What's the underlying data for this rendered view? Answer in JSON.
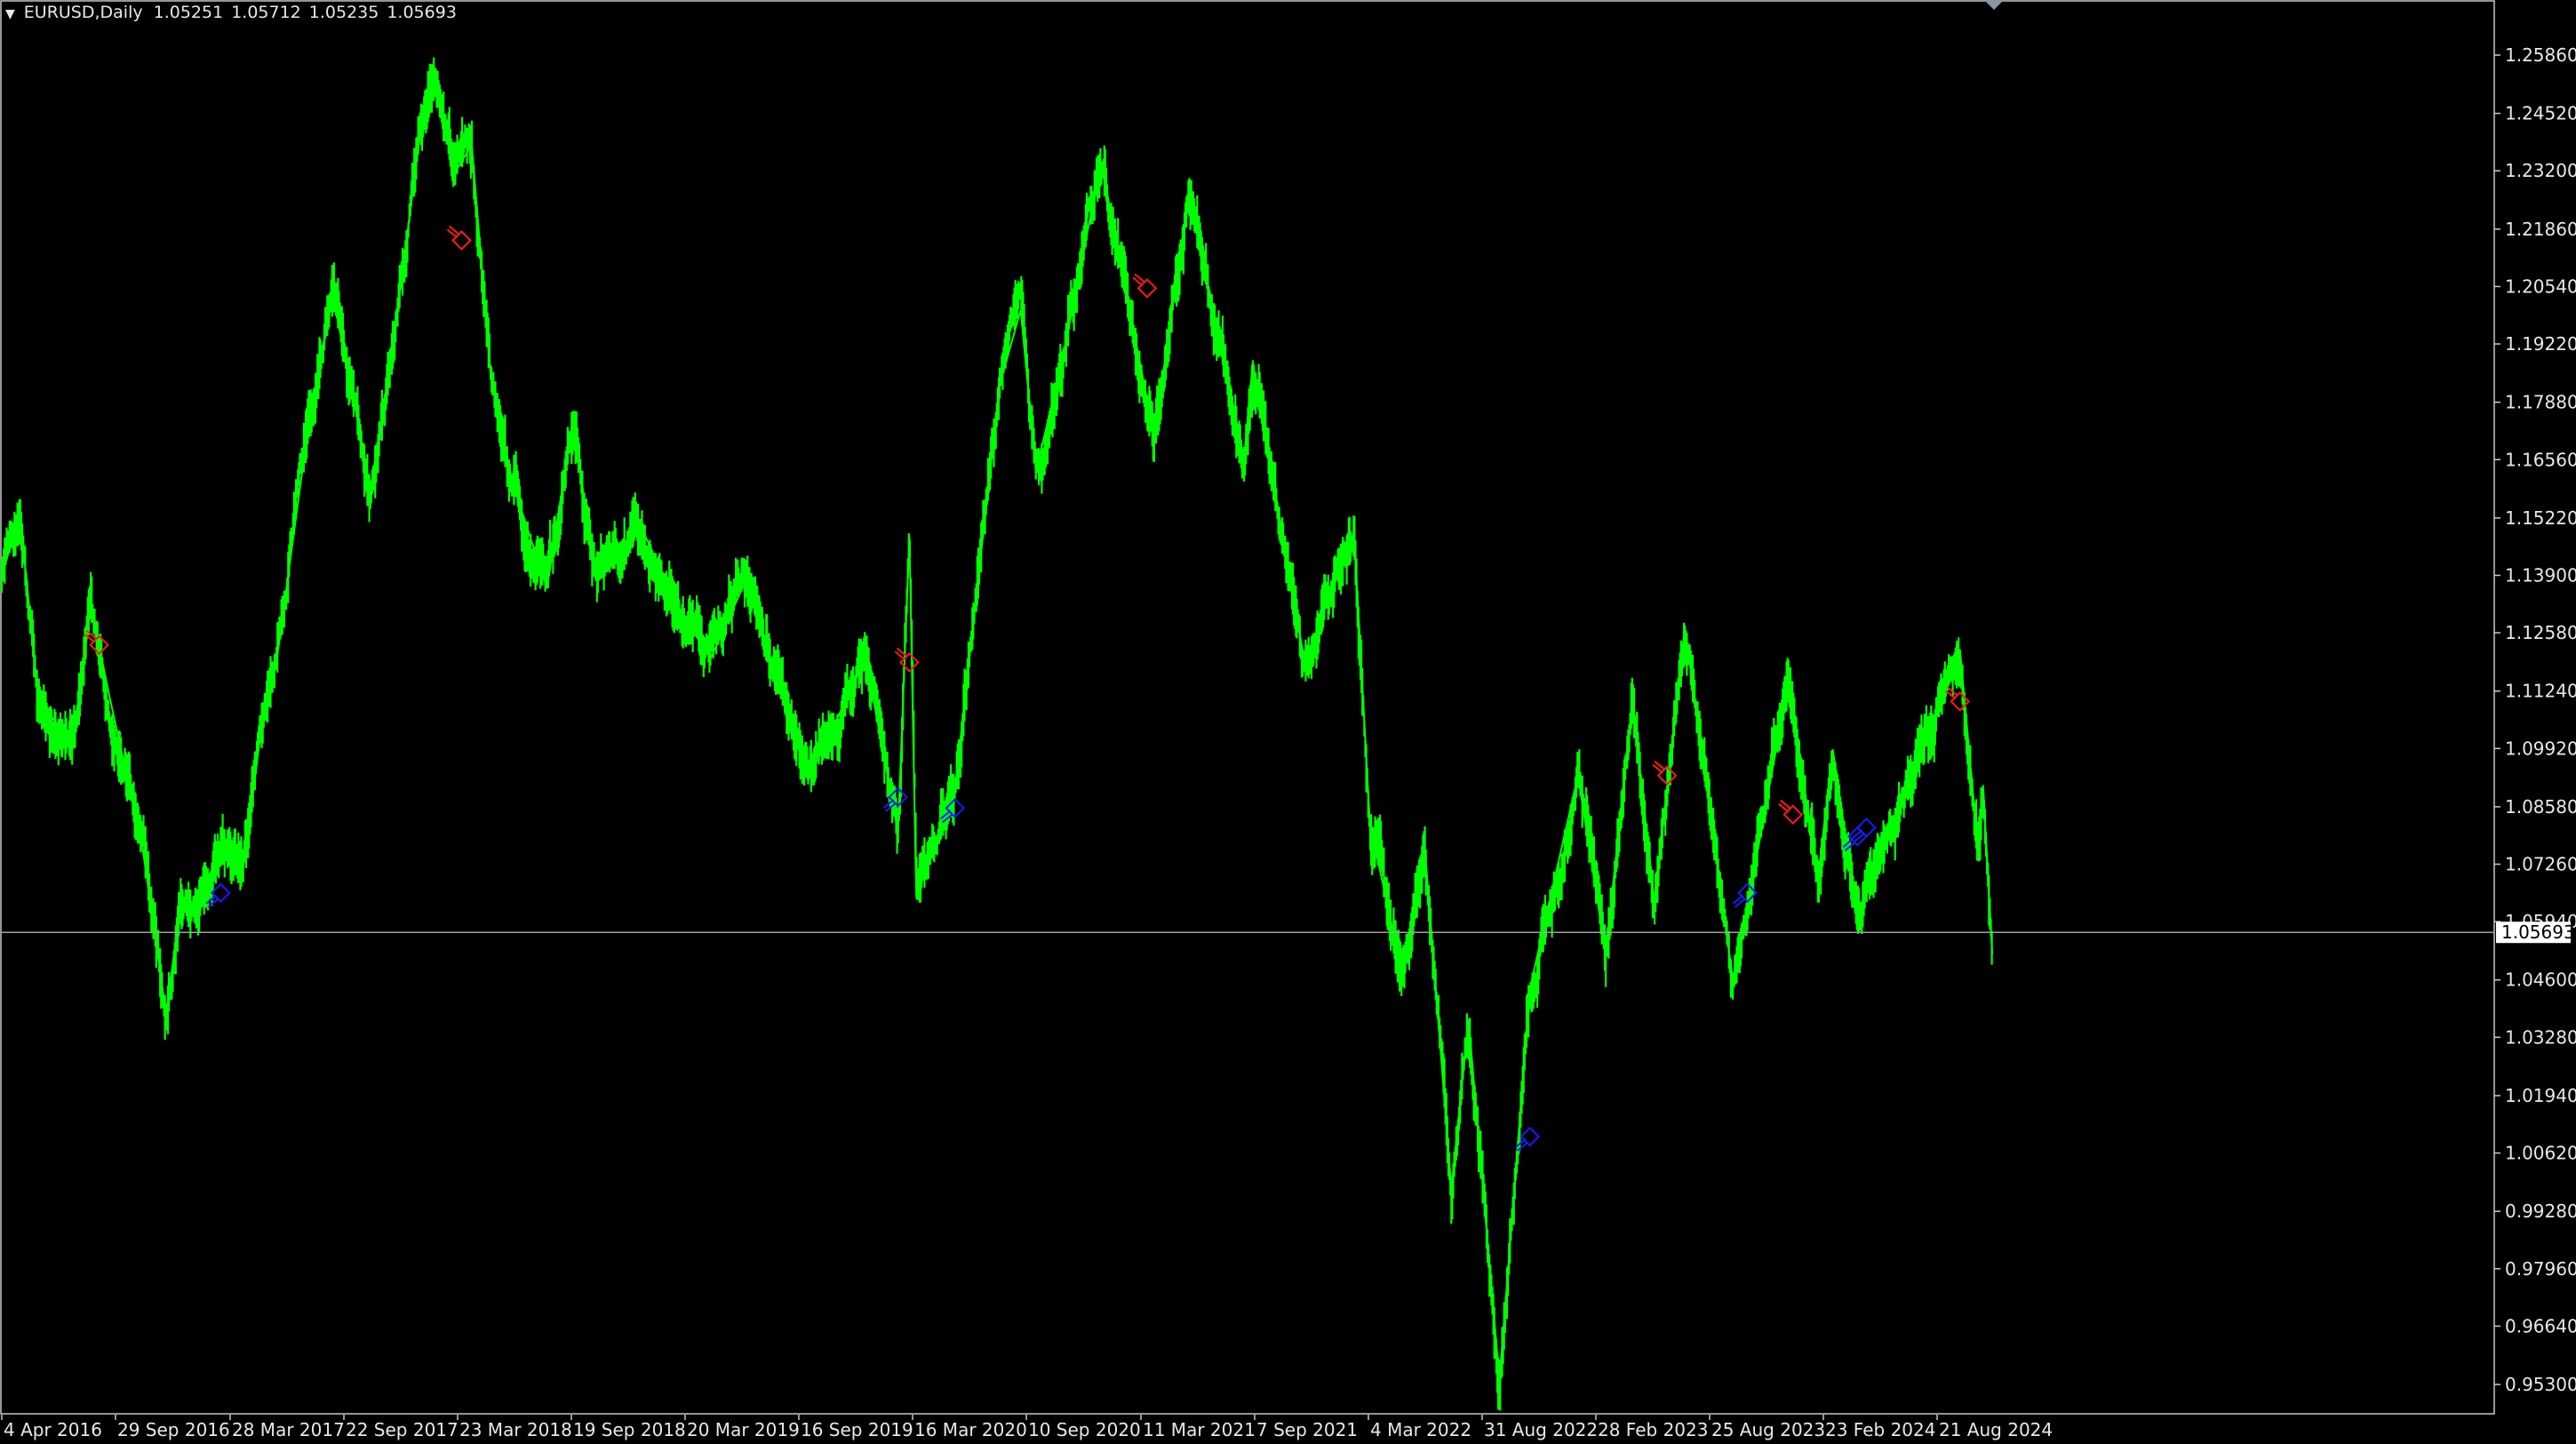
{
  "header": {
    "symbol": "EURUSD,Daily",
    "open": "1.05251",
    "high": "1.05712",
    "low": "1.05235",
    "close": "1.05693"
  },
  "colors": {
    "background": "#000000",
    "price_line": "#00ff00",
    "sell_marker": "#ff1a1a",
    "buy_marker": "#1a1aff",
    "axis_text": "#e8e8e8",
    "grid_frame": "#c8c8c8",
    "current_price_label_bg": "#ffffff",
    "current_price_label_text": "#000000"
  },
  "chart_data": {
    "type": "line",
    "title": "EURUSD,Daily",
    "grid": false,
    "ylim": [
      0.9465,
      1.2645
    ],
    "y_ticks": [
      1.2586,
      1.2452,
      1.232,
      1.2186,
      1.2054,
      1.1922,
      1.1788,
      1.1656,
      1.1522,
      1.139,
      1.1258,
      1.1124,
      1.0992,
      1.0858,
      1.0726,
      1.0594,
      1.046,
      1.0328,
      1.0194,
      1.0062,
      0.9928,
      0.9796,
      0.9664,
      0.953
    ],
    "y_tick_labels": [
      "1.25860",
      "1.24520",
      "1.23200",
      "1.21860",
      "1.20540",
      "1.19220",
      "1.17880",
      "1.16560",
      "1.15220",
      "1.13900",
      "1.12580",
      "1.11240",
      "1.09920",
      "1.08580",
      "1.07260",
      "1.05940",
      "1.04600",
      "1.03280",
      "1.01940",
      "1.00620",
      "0.99280",
      "0.97960",
      "0.96640",
      "0.95300"
    ],
    "x_tick_labels": [
      "4 Apr 2016",
      "29 Sep 2016",
      "28 Mar 2017",
      "22 Sep 2017",
      "23 Mar 2018",
      "19 Sep 2018",
      "20 Mar 2019",
      "16 Sep 2019",
      "16 Mar 2020",
      "10 Sep 2020",
      "11 Mar 2021",
      "7 Sep 2021",
      "4 Mar 2022",
      "31 Aug 2022",
      "28 Feb 2023",
      "25 Aug 2023",
      "23 Feb 2024",
      "21 Aug 2024"
    ],
    "x_range": [
      "2016-04-04",
      "2024-11-15"
    ],
    "current_price": 1.05693,
    "current_price_label": "1.05693",
    "series": [
      {
        "values": [
          {
            "date": "2016-04-04",
            "value": 1.139
          },
          {
            "date": "2016-05-03",
            "value": 1.153
          },
          {
            "date": "2016-05-30",
            "value": 1.113
          },
          {
            "date": "2016-06-24",
            "value": 1.106
          },
          {
            "date": "2016-07-25",
            "value": 1.1
          },
          {
            "date": "2016-08-23",
            "value": 1.132
          },
          {
            "date": "2016-09-20",
            "value": 1.112
          },
          {
            "date": "2016-10-20",
            "value": 1.092
          },
          {
            "date": "2016-11-14",
            "value": 1.075
          },
          {
            "date": "2016-12-20",
            "value": 1.038
          },
          {
            "date": "2017-01-10",
            "value": 1.062
          },
          {
            "date": "2017-02-10",
            "value": 1.065
          },
          {
            "date": "2017-03-20",
            "value": 1.077
          },
          {
            "date": "2017-04-20",
            "value": 1.071
          },
          {
            "date": "2017-05-16",
            "value": 1.1
          },
          {
            "date": "2017-06-15",
            "value": 1.122
          },
          {
            "date": "2017-07-25",
            "value": 1.165
          },
          {
            "date": "2017-09-08",
            "value": 1.204
          },
          {
            "date": "2017-10-12",
            "value": 1.18
          },
          {
            "date": "2017-11-07",
            "value": 1.158
          },
          {
            "date": "2017-12-12",
            "value": 1.19
          },
          {
            "date": "2018-01-25",
            "value": 1.24
          },
          {
            "date": "2018-02-16",
            "value": 1.252
          },
          {
            "date": "2018-03-23",
            "value": 1.232
          },
          {
            "date": "2018-04-17",
            "value": 1.238
          },
          {
            "date": "2018-05-17",
            "value": 1.185
          },
          {
            "date": "2018-06-21",
            "value": 1.16
          },
          {
            "date": "2018-08-14",
            "value": 1.136
          },
          {
            "date": "2018-09-24",
            "value": 1.175
          },
          {
            "date": "2018-10-30",
            "value": 1.138
          },
          {
            "date": "2019-01-10",
            "value": 1.15
          },
          {
            "date": "2019-03-15",
            "value": 1.13
          },
          {
            "date": "2019-04-30",
            "value": 1.12
          },
          {
            "date": "2019-06-25",
            "value": 1.138
          },
          {
            "date": "2019-08-20",
            "value": 1.112
          },
          {
            "date": "2019-10-01",
            "value": 1.092
          },
          {
            "date": "2019-12-31",
            "value": 1.12
          },
          {
            "date": "2020-02-20",
            "value": 1.08
          },
          {
            "date": "2020-03-09",
            "value": 1.148
          },
          {
            "date": "2020-03-20",
            "value": 1.065
          },
          {
            "date": "2020-05-20",
            "value": 1.09
          },
          {
            "date": "2020-07-30",
            "value": 1.183
          },
          {
            "date": "2020-09-01",
            "value": 1.2
          },
          {
            "date": "2020-09-25",
            "value": 1.163
          },
          {
            "date": "2020-11-04",
            "value": 1.187
          },
          {
            "date": "2021-01-06",
            "value": 1.234
          },
          {
            "date": "2021-03-31",
            "value": 1.171
          },
          {
            "date": "2021-05-25",
            "value": 1.227
          },
          {
            "date": "2021-08-20",
            "value": 1.166
          },
          {
            "date": "2021-09-03",
            "value": 1.188
          },
          {
            "date": "2021-11-24",
            "value": 1.119
          },
          {
            "date": "2022-02-10",
            "value": 1.149
          },
          {
            "date": "2022-03-07",
            "value": 1.082
          },
          {
            "date": "2022-04-28",
            "value": 1.047
          },
          {
            "date": "2022-06-01",
            "value": 1.078
          },
          {
            "date": "2022-07-14",
            "value": 0.998
          },
          {
            "date": "2022-08-10",
            "value": 1.037
          },
          {
            "date": "2022-09-28",
            "value": 0.954
          },
          {
            "date": "2022-11-15",
            "value": 1.044
          },
          {
            "date": "2023-01-30",
            "value": 1.093
          },
          {
            "date": "2023-03-15",
            "value": 1.052
          },
          {
            "date": "2023-04-26",
            "value": 1.11
          },
          {
            "date": "2023-05-31",
            "value": 1.064
          },
          {
            "date": "2023-07-18",
            "value": 1.127
          },
          {
            "date": "2023-10-03",
            "value": 1.045
          },
          {
            "date": "2023-12-28",
            "value": 1.114
          },
          {
            "date": "2024-02-14",
            "value": 1.07
          },
          {
            "date": "2024-03-08",
            "value": 1.099
          },
          {
            "date": "2024-04-16",
            "value": 1.06
          },
          {
            "date": "2024-07-17",
            "value": 1.095
          },
          {
            "date": "2024-09-25",
            "value": 1.122
          },
          {
            "date": "2024-10-23",
            "value": 1.077
          },
          {
            "date": "2024-11-01",
            "value": 1.09
          },
          {
            "date": "2024-11-15",
            "value": 1.052
          }
        ]
      }
    ],
    "markers": [
      {
        "type": "sell",
        "date": "2016-09-05",
        "value": 1.123
      },
      {
        "type": "buy",
        "date": "2017-03-16",
        "value": 1.066
      },
      {
        "type": "sell",
        "date": "2018-04-01",
        "value": 1.216
      },
      {
        "type": "buy",
        "date": "2020-02-20",
        "value": 1.088
      },
      {
        "type": "sell",
        "date": "2020-03-09",
        "value": 1.119
      },
      {
        "type": "buy",
        "date": "2020-05-20",
        "value": 1.0855
      },
      {
        "type": "sell",
        "date": "2021-03-20",
        "value": 1.205
      },
      {
        "type": "buy",
        "date": "2022-11-15",
        "value": 1.01
      },
      {
        "type": "sell",
        "date": "2023-06-20",
        "value": 1.093
      },
      {
        "type": "buy",
        "date": "2023-10-25",
        "value": 1.066
      },
      {
        "type": "sell",
        "date": "2024-01-05",
        "value": 1.084
      },
      {
        "type": "buy",
        "date": "2024-04-16",
        "value": 1.079
      },
      {
        "type": "buy",
        "date": "2024-04-30",
        "value": 1.081
      },
      {
        "type": "sell",
        "date": "2024-09-25",
        "value": 1.11
      }
    ]
  }
}
